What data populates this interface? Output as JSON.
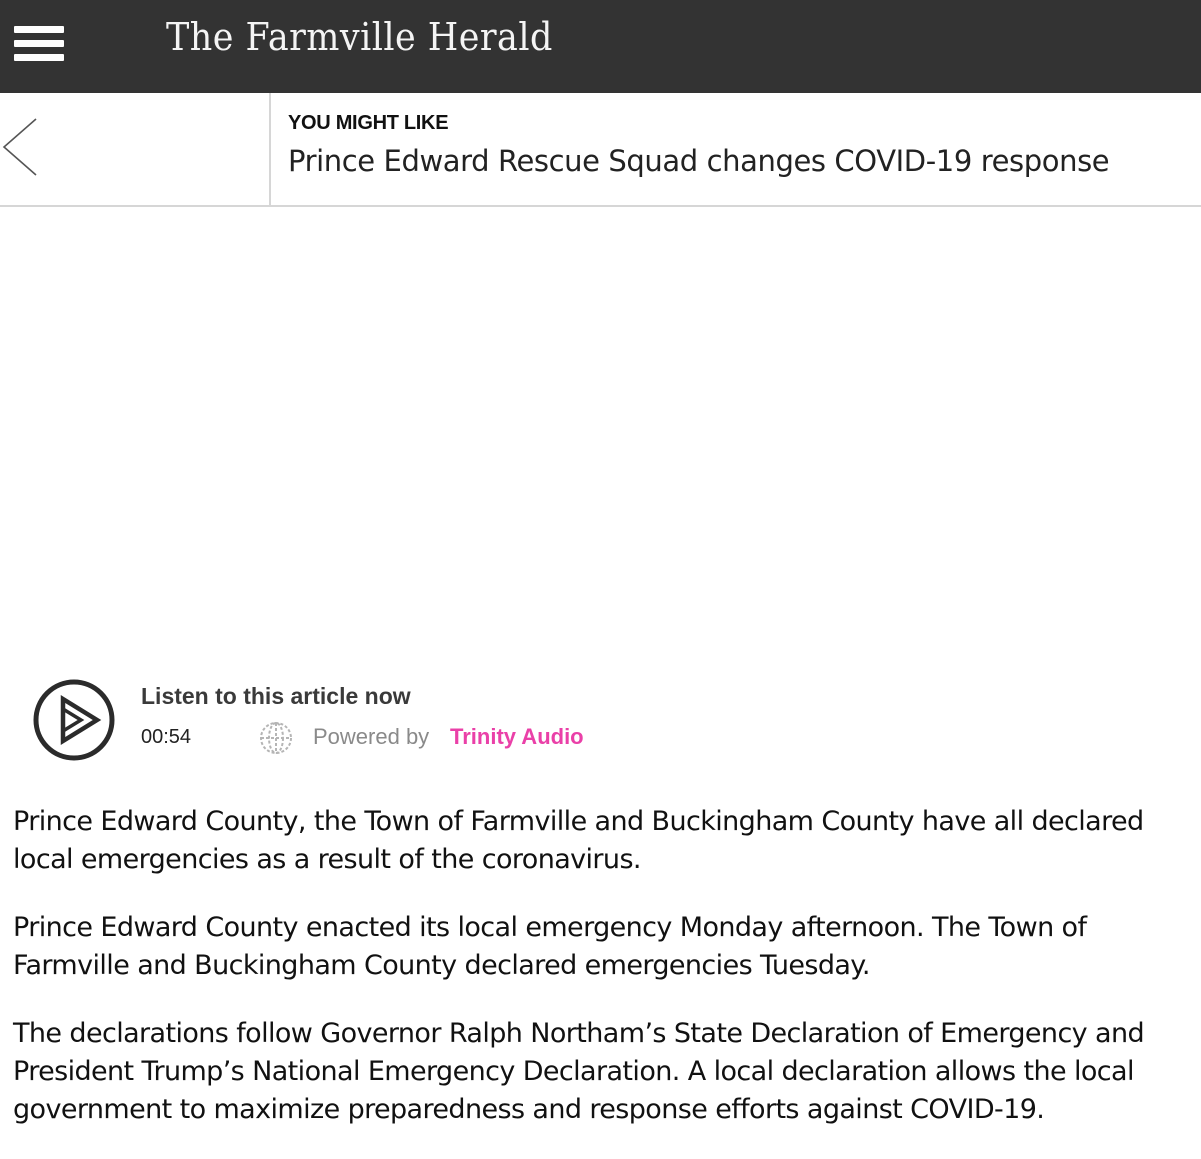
{
  "header": {
    "masthead": "The Farmville Herald",
    "menu_icon": "hamburger-menu-icon",
    "background_color": "#333333"
  },
  "related": {
    "kicker": "YOU MIGHT LIKE",
    "title": "Prince Edward Rescue Squad changes COVID-19 response",
    "prev_icon": "chevron-left-icon"
  },
  "player": {
    "label": "Listen to this article now",
    "duration": "00:54",
    "powered_by": "Powered by",
    "brand": "Trinity Audio",
    "brand_color": "#ea40a8",
    "play_icon": "play-icon",
    "globe_icon": "globe-icon"
  },
  "article": {
    "paragraphs": [
      "Prince Edward County, the Town of Farmville and Buckingham County have all declared local emergencies as a result of the coronavirus.",
      "Prince Edward County enacted its local emergency Monday afternoon. The Town of Farmville and Buckingham County declared emergencies Tuesday.",
      "The declarations follow Governor Ralph Northam’s State Declaration of Emergency and President Trump’s National Emergency Declaration. A local declaration allows the local government to maximize preparedness and response efforts against COVID-19."
    ]
  }
}
